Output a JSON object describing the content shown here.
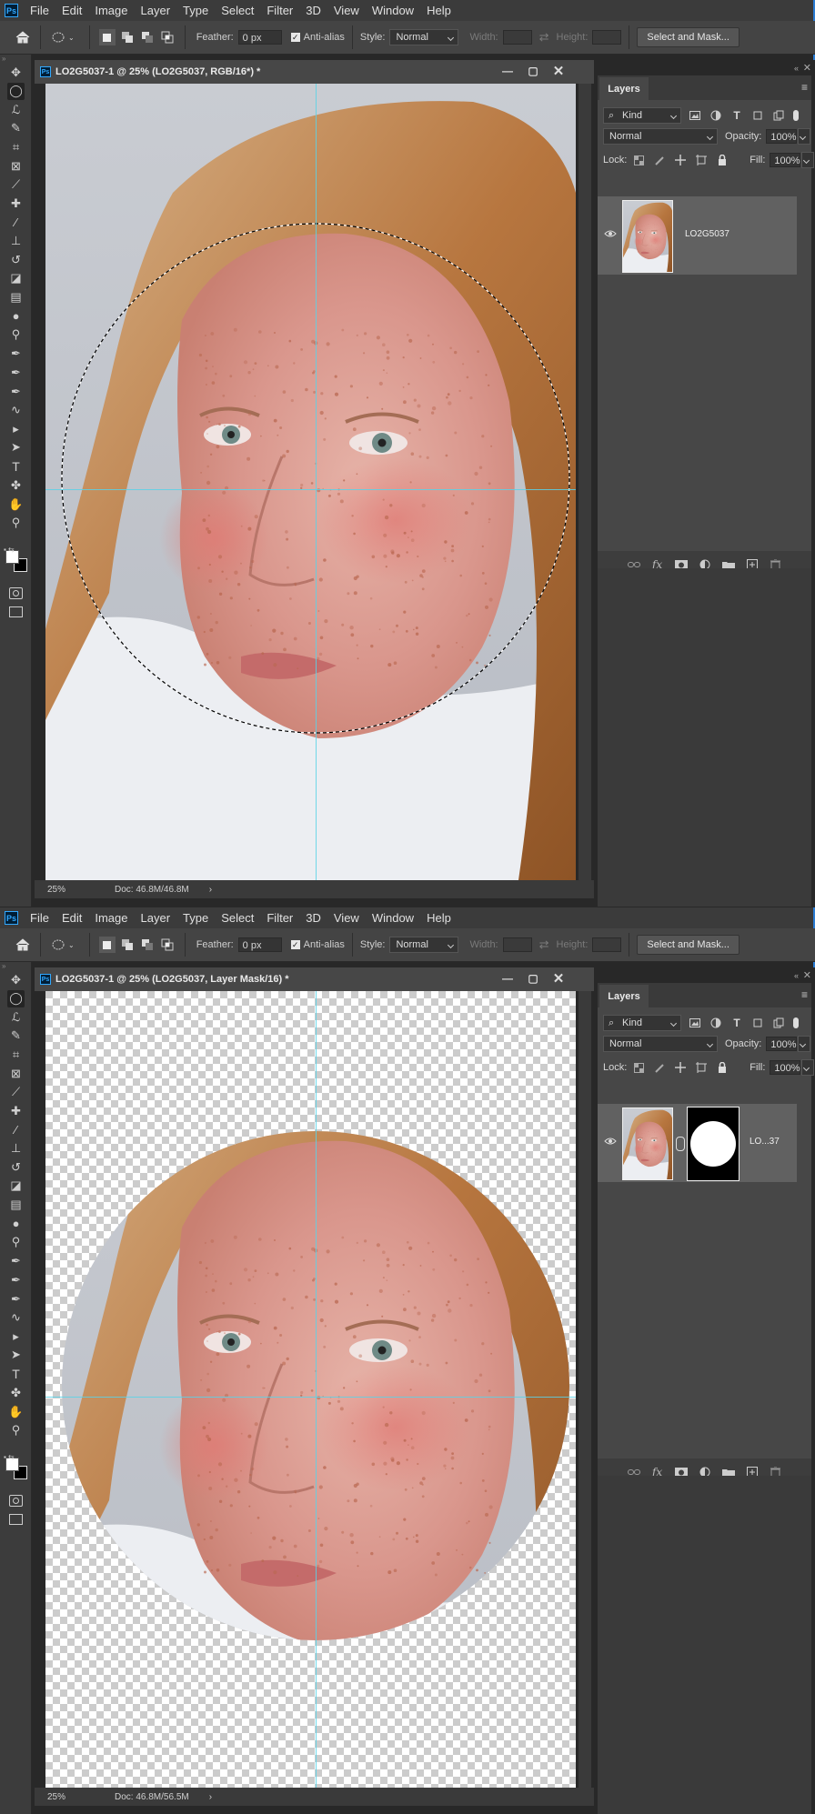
{
  "app": {
    "logo": "Ps",
    "blue_edge_color": "#2b7cd3"
  },
  "menu": [
    "File",
    "Edit",
    "Image",
    "Layer",
    "Type",
    "Select",
    "Filter",
    "3D",
    "View",
    "Window",
    "Help"
  ],
  "options": {
    "feather_label": "Feather:",
    "feather_value": "0 px",
    "antialias_label": "Anti-alias",
    "style_label": "Style:",
    "style_value": "Normal",
    "width_label": "Width:",
    "height_label": "Height:",
    "select_mask_label": "Select and Mask..."
  },
  "toolbar_icons": [
    "move-icon",
    "elliptical-marquee-icon",
    "lasso-icon",
    "quick-selection-icon",
    "crop-icon",
    "frame-icon",
    "eyedropper-icon",
    "healing-brush-icon",
    "brush-icon",
    "clone-stamp-icon",
    "history-brush-icon",
    "eraser-icon",
    "gradient-icon",
    "blur-icon",
    "dodge-icon",
    "pen-icon",
    "type-on-path-icon",
    "freeform-pen-icon",
    "curvature-pen-icon",
    "path-selection-icon",
    "direct-selection-icon",
    "type-icon",
    "custom-shape-icon",
    "hand-icon",
    "zoom-icon"
  ],
  "screens": [
    {
      "doc_title": "LO2G5037-1 @ 25% (LO2G5037, RGB/16*) *",
      "zoom": "25%",
      "doc_size": "Doc: 46.8M/46.8M",
      "layer_name": "LO2G5037",
      "has_mask": false,
      "has_selection": true
    },
    {
      "doc_title": "LO2G5037-1 @ 25% (LO2G5037, Layer Mask/16) *",
      "zoom": "25%",
      "doc_size": "Doc: 46.8M/56.5M",
      "layer_name": "LO...37",
      "has_mask": true,
      "has_selection": false
    }
  ],
  "layers_panel": {
    "tab": "Layers",
    "filter_kind": "Kind",
    "blend_mode": "Normal",
    "opacity_label": "Opacity:",
    "opacity_value": "100%",
    "lock_label": "Lock:",
    "fill_label": "Fill:",
    "fill_value": "100%"
  },
  "colors": {
    "guide": "#59d2e8",
    "panel_bg": "#474747",
    "app_bg": "#282828"
  }
}
